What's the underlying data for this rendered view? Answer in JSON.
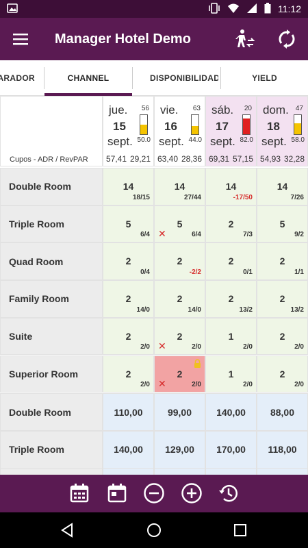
{
  "status_bar": {
    "time": "11:12"
  },
  "app_bar": {
    "title": "Manager Hotel Demo"
  },
  "tabs": [
    {
      "label": "PARADOR"
    },
    {
      "label": "CHANNEL"
    },
    {
      "label": "DISPONIBILIDAD"
    },
    {
      "label": "YIELD"
    }
  ],
  "header": {
    "corner_label": "Cupos - ADR / RevPAR"
  },
  "days": [
    {
      "weekday": "jue.",
      "day": "15",
      "month": "sept.",
      "occupancy": "56",
      "occupancy_pct": "50.0",
      "fill": 0.5,
      "fill_color": "#f5c400",
      "adr": "57,41",
      "revpar": "29,21",
      "header_bg": "#ffffff"
    },
    {
      "weekday": "vie.",
      "day": "16",
      "month": "sept.",
      "occupancy": "63",
      "occupancy_pct": "44.0",
      "fill": 0.44,
      "fill_color": "#f5c400",
      "adr": "63,40",
      "revpar": "28,36",
      "header_bg": "#ffffff"
    },
    {
      "weekday": "sáb.",
      "day": "17",
      "month": "sept.",
      "occupancy": "20",
      "occupancy_pct": "82.0",
      "fill": 0.82,
      "fill_color": "#e02020",
      "adr": "69,31",
      "revpar": "57,15",
      "header_bg": "#f3e1f1"
    },
    {
      "weekday": "dom.",
      "day": "18",
      "month": "sept.",
      "occupancy": "47",
      "occupancy_pct": "58.0",
      "fill": 0.58,
      "fill_color": "#f5c400",
      "adr": "54,93",
      "revpar": "32,28",
      "header_bg": "#f3e1f1"
    }
  ],
  "availability_rows": [
    {
      "room": "Double Room",
      "cells": [
        {
          "value": "14",
          "sub": "18/15",
          "neg": false,
          "x": false,
          "lock": false,
          "closed": false
        },
        {
          "value": "14",
          "sub": "27/44",
          "neg": false,
          "x": false,
          "lock": false,
          "closed": false
        },
        {
          "value": "14",
          "sub": "-17/50",
          "neg": true,
          "x": false,
          "lock": false,
          "closed": false
        },
        {
          "value": "14",
          "sub": "7/26",
          "neg": false,
          "x": false,
          "lock": false,
          "closed": false
        }
      ]
    },
    {
      "room": "Triple Room",
      "cells": [
        {
          "value": "5",
          "sub": "6/4",
          "neg": false,
          "x": false,
          "lock": false,
          "closed": false
        },
        {
          "value": "5",
          "sub": "6/4",
          "neg": false,
          "x": true,
          "lock": false,
          "closed": false
        },
        {
          "value": "2",
          "sub": "7/3",
          "neg": false,
          "x": false,
          "lock": false,
          "closed": false
        },
        {
          "value": "5",
          "sub": "9/2",
          "neg": false,
          "x": false,
          "lock": false,
          "closed": false
        }
      ]
    },
    {
      "room": "Quad Room",
      "cells": [
        {
          "value": "2",
          "sub": "0/4",
          "neg": false,
          "x": false,
          "lock": false,
          "closed": false
        },
        {
          "value": "2",
          "sub": "-2/2",
          "neg": true,
          "x": false,
          "lock": false,
          "closed": false
        },
        {
          "value": "2",
          "sub": "0/1",
          "neg": false,
          "x": false,
          "lock": false,
          "closed": false
        },
        {
          "value": "2",
          "sub": "1/1",
          "neg": false,
          "x": false,
          "lock": false,
          "closed": false
        }
      ]
    },
    {
      "room": "Family Room",
      "cells": [
        {
          "value": "2",
          "sub": "14/0",
          "neg": false,
          "x": false,
          "lock": false,
          "closed": false
        },
        {
          "value": "2",
          "sub": "14/0",
          "neg": false,
          "x": false,
          "lock": false,
          "closed": false
        },
        {
          "value": "2",
          "sub": "13/2",
          "neg": false,
          "x": false,
          "lock": false,
          "closed": false
        },
        {
          "value": "2",
          "sub": "13/2",
          "neg": false,
          "x": false,
          "lock": false,
          "closed": false
        }
      ]
    },
    {
      "room": "Suite",
      "cells": [
        {
          "value": "2",
          "sub": "2/0",
          "neg": false,
          "x": false,
          "lock": false,
          "closed": false
        },
        {
          "value": "2",
          "sub": "2/0",
          "neg": false,
          "x": true,
          "lock": false,
          "closed": false
        },
        {
          "value": "1",
          "sub": "2/0",
          "neg": false,
          "x": false,
          "lock": false,
          "closed": false
        },
        {
          "value": "2",
          "sub": "2/0",
          "neg": false,
          "x": false,
          "lock": false,
          "closed": false
        }
      ]
    },
    {
      "room": "Superior Room",
      "cells": [
        {
          "value": "2",
          "sub": "2/0",
          "neg": false,
          "x": false,
          "lock": false,
          "closed": false
        },
        {
          "value": "2",
          "sub": "2/0",
          "neg": false,
          "x": true,
          "lock": true,
          "closed": true
        },
        {
          "value": "1",
          "sub": "2/0",
          "neg": false,
          "x": false,
          "lock": false,
          "closed": false
        },
        {
          "value": "2",
          "sub": "2/0",
          "neg": false,
          "x": false,
          "lock": false,
          "closed": false
        }
      ]
    }
  ],
  "price_rows": [
    {
      "room": "Double Room",
      "prices": [
        "110,00",
        "99,00",
        "140,00",
        "88,00"
      ]
    },
    {
      "room": "Triple Room",
      "prices": [
        "140,00",
        "129,00",
        "170,00",
        "118,00"
      ]
    }
  ],
  "colors": {
    "brand": "#5a1a52",
    "avail_bg": "#eff6e6",
    "price_bg": "#e4eef9",
    "closed_bg": "#f2a3a3",
    "negative": "#d62b2b"
  },
  "bottom_actions": [
    "calendar-range-icon",
    "calendar-day-icon",
    "minus-circle-icon",
    "plus-circle-icon",
    "restore-icon"
  ]
}
